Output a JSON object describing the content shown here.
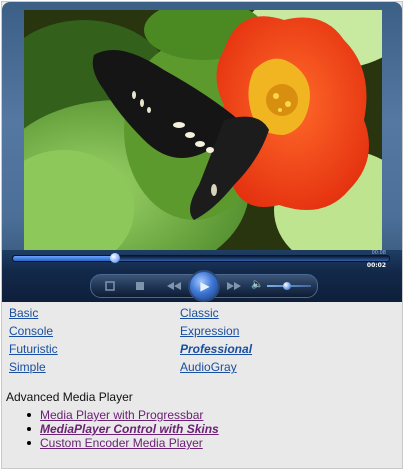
{
  "player": {
    "progress_percent": 27,
    "volume_percent": 45,
    "time_total": "00:08",
    "time_current": "00:02",
    "icons": {
      "fullscreen": "fullscreen-icon",
      "stop": "stop-icon",
      "rewind": "rewind-icon",
      "play": "play-icon",
      "fast_forward": "fast-forward-icon",
      "volume": "speaker-icon"
    }
  },
  "skins": {
    "left": [
      "Basic",
      "Console",
      "Futuristic",
      "Simple"
    ],
    "right": [
      "Classic",
      "Expression",
      "Professional",
      "AudioGray"
    ]
  },
  "advanced": {
    "title": "Advanced Media Player",
    "links": [
      "Media Player with Progressbar",
      "MediaPlayer Control with Skins",
      "Custom Encoder Media Player"
    ]
  },
  "colors": {
    "link": "#1a4fa0",
    "visited_link": "#6b2174",
    "player_blue": "#3f78d6"
  }
}
